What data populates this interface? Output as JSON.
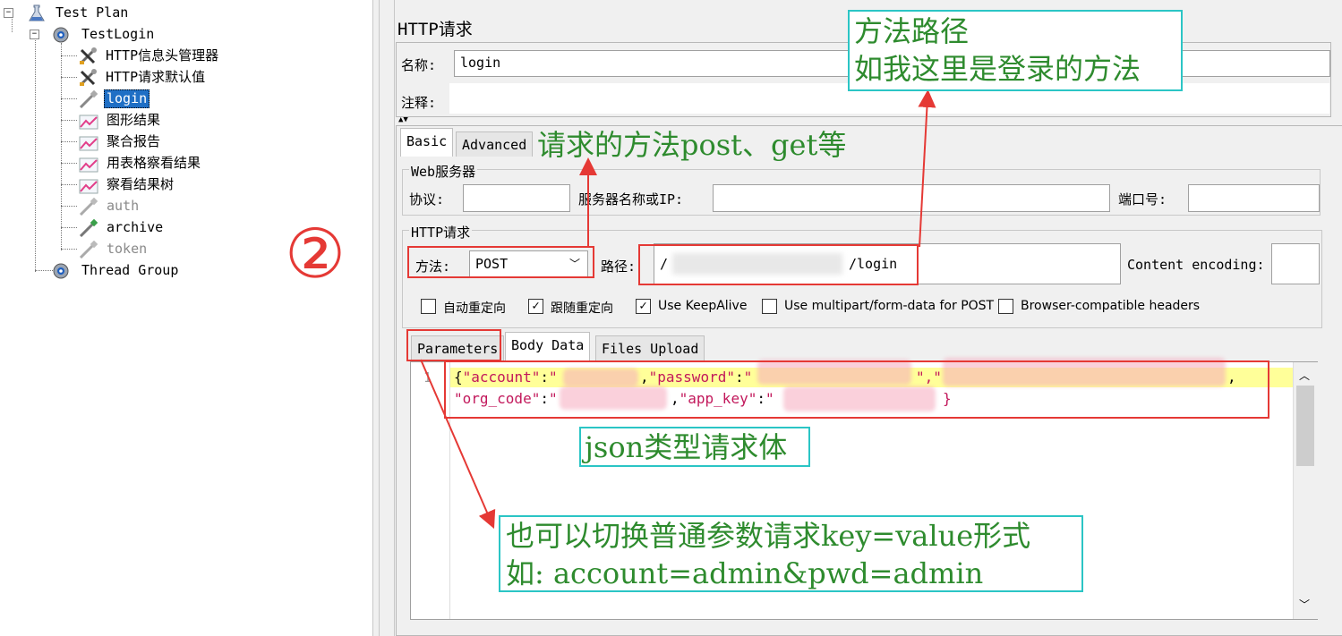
{
  "tree": {
    "root": "Test Plan",
    "testlogin": "TestLogin",
    "items": [
      {
        "label": "HTTP信息头管理器"
      },
      {
        "label": "HTTP请求默认值"
      },
      {
        "label": "login"
      },
      {
        "label": "图形结果"
      },
      {
        "label": "聚合报告"
      },
      {
        "label": "用表格察看结果"
      },
      {
        "label": "察看结果树"
      },
      {
        "label": "auth"
      },
      {
        "label": "archive"
      },
      {
        "label": "token"
      }
    ],
    "thread_group": "Thread Group"
  },
  "marker": "②",
  "panel": {
    "title": "HTTP请求",
    "name_label": "名称:",
    "name_value": "login",
    "comment_label": "注释:"
  },
  "tabs": {
    "basic": "Basic",
    "advanced": "Advanced"
  },
  "web_server": {
    "group_title": "Web服务器",
    "protocol_label": "协议:",
    "server_label": "服务器名称或IP:",
    "port_label": "端口号:"
  },
  "http_request": {
    "group_title": "HTTP请求",
    "method_label": "方法:",
    "method_value": "POST",
    "path_label": "路径:",
    "path_prefix": "/",
    "path_suffix": "/login",
    "encoding_label": "Content encoding:"
  },
  "checkboxes": [
    {
      "label": "自动重定向",
      "checked": false
    },
    {
      "label": "跟随重定向",
      "checked": true
    },
    {
      "label": "Use KeepAlive",
      "checked": true
    },
    {
      "label": "Use multipart/form-data for POST",
      "checked": false
    },
    {
      "label": "Browser-compatible headers",
      "checked": false
    }
  ],
  "sub_tabs": {
    "parameters": "Parameters",
    "body_data": "Body Data",
    "files_upload": "Files Upload"
  },
  "body": {
    "line1_no": "1",
    "tok_open": "{",
    "k_account": "\"account\"",
    "colon": ":",
    "q": "\"",
    "comma_q": ",",
    "k_password": "\"password\"",
    "dq_comma_dq": "\",\"",
    "k_org_code": "\"org_code\"",
    "k_app_key": "\"app_key\"",
    "tok_close": "}"
  },
  "annotations": {
    "method_path_1": "方法路径",
    "method_path_2": "如我这里是登录的方法",
    "request_method": "请求的方法post、get等",
    "json_body": "json类型请求体",
    "switch_1": "也可以切换普通参数请求key=value形式",
    "switch_2": "如: account=admin&pwd=admin"
  },
  "colors": {
    "annotation_text": "#2e8b2e",
    "red_box": "#e53935",
    "cyan_box": "#2bc5c5",
    "json_key": "#c2185b",
    "highlight": "#ffff99",
    "selection": "#1f6fc5"
  }
}
